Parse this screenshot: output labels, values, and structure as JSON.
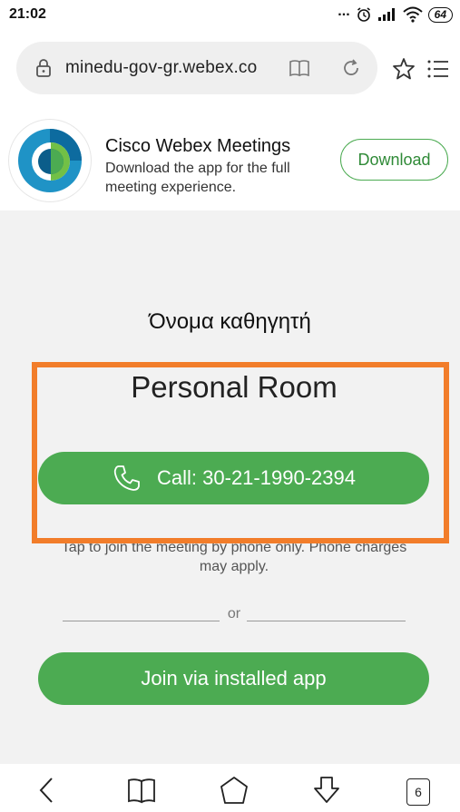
{
  "status_bar": {
    "time": "21:02",
    "dots": "...",
    "battery": "64",
    "icons": [
      "alarm-icon",
      "signal-icon",
      "wifi-icon",
      "battery-icon"
    ]
  },
  "browser": {
    "url": "minedu-gov-gr.webex.co",
    "icons": [
      "lock-icon",
      "reader-mode-icon",
      "reload-icon",
      "star-icon",
      "menu-icon"
    ]
  },
  "banner": {
    "app_name": "Cisco Webex Meetings",
    "description": "Download the app for the full meeting experience.",
    "download_label": "Download"
  },
  "meeting": {
    "host_name": "Όνομα καθηγητή",
    "room_title": "Personal Room",
    "call_label": "Call: 30-21-1990-2394",
    "phone_note": "Tap to join the meeting by phone only. Phone charges may apply.",
    "or_label": "or",
    "join_label": "Join via installed app"
  },
  "nav": {
    "tab_count": "6",
    "icons": [
      "back-icon",
      "bookmarks-icon",
      "home-icon",
      "downloads-icon",
      "tabs-icon"
    ]
  },
  "colors": {
    "accent_green": "#4cab52",
    "highlight_orange": "#f27d2a"
  }
}
